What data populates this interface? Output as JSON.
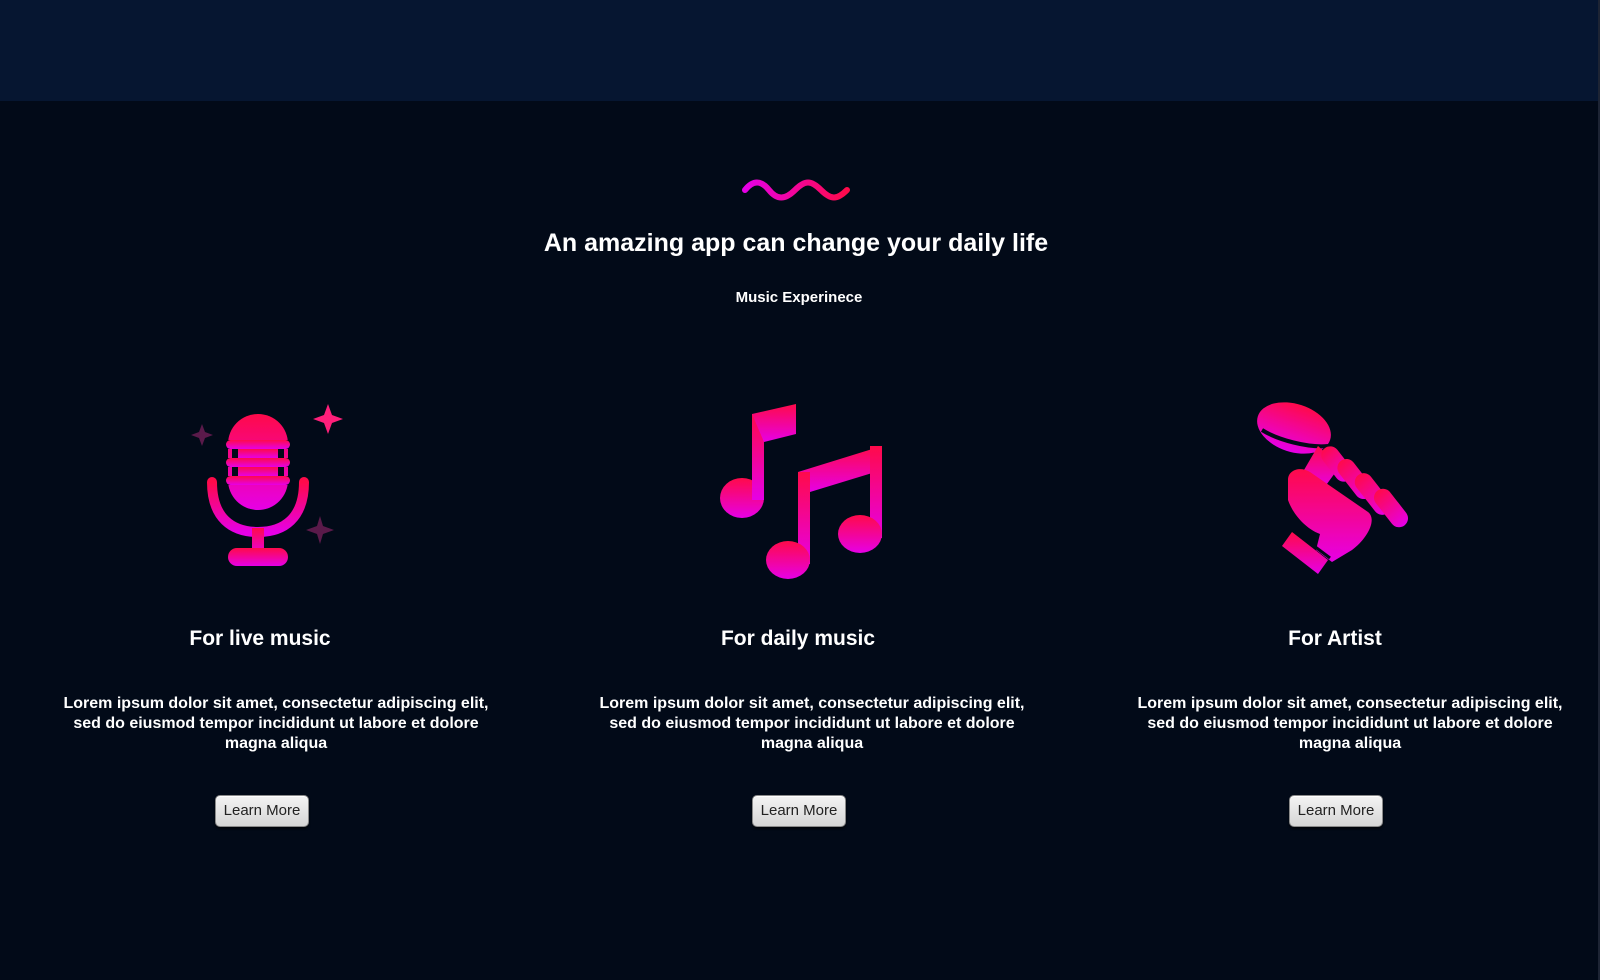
{
  "hero": {
    "headline": "An amazing app can change your daily life",
    "subheadline": "Music Experinece",
    "decoration_icon": "wave-squiggle"
  },
  "colors": {
    "page_background": "#020a18",
    "topbar_background": "#061631",
    "gradient_start": "#ff0a4a",
    "gradient_end": "#e600e6",
    "sparkle_dim": "#5a1a4a"
  },
  "cards": [
    {
      "icon": "microphone-sparkle-icon",
      "title": "For live music",
      "text": "Lorem ipsum dolor sit amet, consectetur adipiscing elit, sed do eiusmod tempor incididunt ut labore et dolore magna aliqua",
      "button_label": "Learn More"
    },
    {
      "icon": "music-notes-icon",
      "title": "For daily music",
      "text": "Lorem ipsum dolor sit amet, consectetur adipiscing elit, sed do eiusmod tempor incididunt ut labore et dolore magna aliqua",
      "button_label": "Learn More"
    },
    {
      "icon": "hand-microphone-icon",
      "title": "For Artist",
      "text": "Lorem ipsum dolor sit amet, consectetur adipiscing elit, sed do eiusmod tempor incididunt ut labore et dolore magna aliqua",
      "button_label": "Learn More"
    }
  ]
}
